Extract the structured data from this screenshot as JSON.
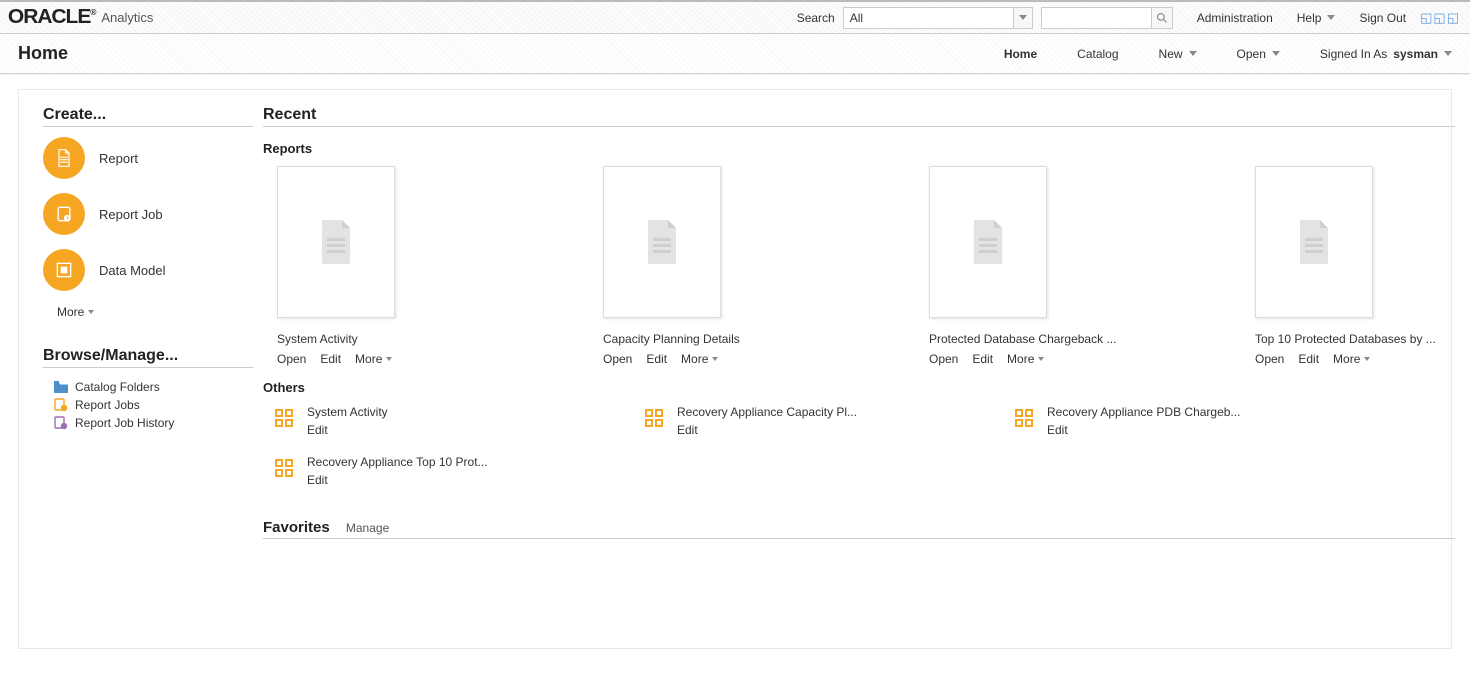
{
  "header": {
    "brand": "ORACLE",
    "app": "Analytics",
    "search_label": "Search",
    "search_scope": "All",
    "admin": "Administration",
    "help": "Help",
    "signout": "Sign Out"
  },
  "nav": {
    "title": "Home",
    "home": "Home",
    "catalog": "Catalog",
    "new": "New",
    "open": "Open",
    "signed_in_as": "Signed In As",
    "username": "sysman"
  },
  "create": {
    "heading": "Create...",
    "items": [
      {
        "label": "Report",
        "icon": "report-icon"
      },
      {
        "label": "Report Job",
        "icon": "report-job-icon"
      },
      {
        "label": "Data Model",
        "icon": "data-model-icon"
      }
    ],
    "more": "More"
  },
  "manage": {
    "heading": "Browse/Manage...",
    "items": [
      {
        "label": "Catalog Folders",
        "icon": "folder-icon"
      },
      {
        "label": "Report Jobs",
        "icon": "jobs-icon"
      },
      {
        "label": "Report Job History",
        "icon": "history-icon"
      }
    ]
  },
  "recent": {
    "heading": "Recent",
    "reports_heading": "Reports",
    "reports": [
      {
        "title": "System Activity",
        "open": "Open",
        "edit": "Edit",
        "more": "More"
      },
      {
        "title": "Capacity Planning Details",
        "open": "Open",
        "edit": "Edit",
        "more": "More"
      },
      {
        "title": "Protected Database Chargeback ...",
        "open": "Open",
        "edit": "Edit",
        "more": "More"
      },
      {
        "title": "Top 10 Protected Databases by ...",
        "open": "Open",
        "edit": "Edit",
        "more": "More"
      }
    ],
    "others_heading": "Others",
    "others": [
      {
        "title": "System Activity",
        "edit": "Edit"
      },
      {
        "title": "Recovery Appliance Capacity Pl...",
        "edit": "Edit"
      },
      {
        "title": "Recovery Appliance PDB Chargeb...",
        "edit": "Edit"
      },
      {
        "title": "Recovery Appliance Top 10 Prot...",
        "edit": "Edit"
      }
    ]
  },
  "favorites": {
    "heading": "Favorites",
    "manage": "Manage"
  }
}
